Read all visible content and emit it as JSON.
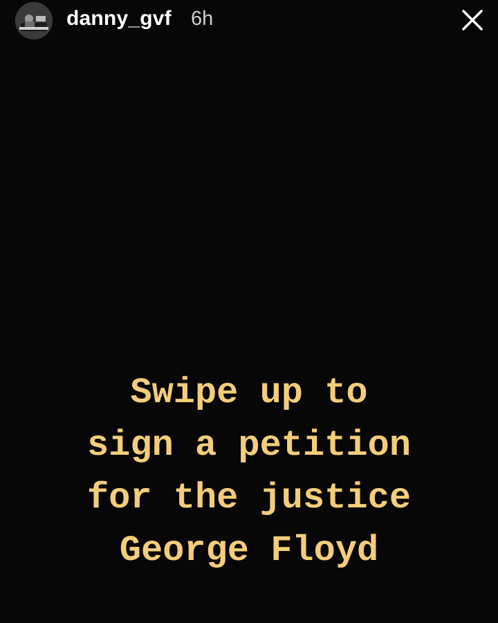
{
  "story": {
    "username": "danny_gvf",
    "timestamp": "6h",
    "close_icon": "close-icon",
    "avatar_icon": "avatar",
    "message_lines": [
      "Swipe up to",
      "sign a petition",
      "for the justice",
      "George Floyd"
    ],
    "colors": {
      "background": "#070707",
      "text": "#f4cd7a",
      "header_text": "#ffffff"
    }
  }
}
